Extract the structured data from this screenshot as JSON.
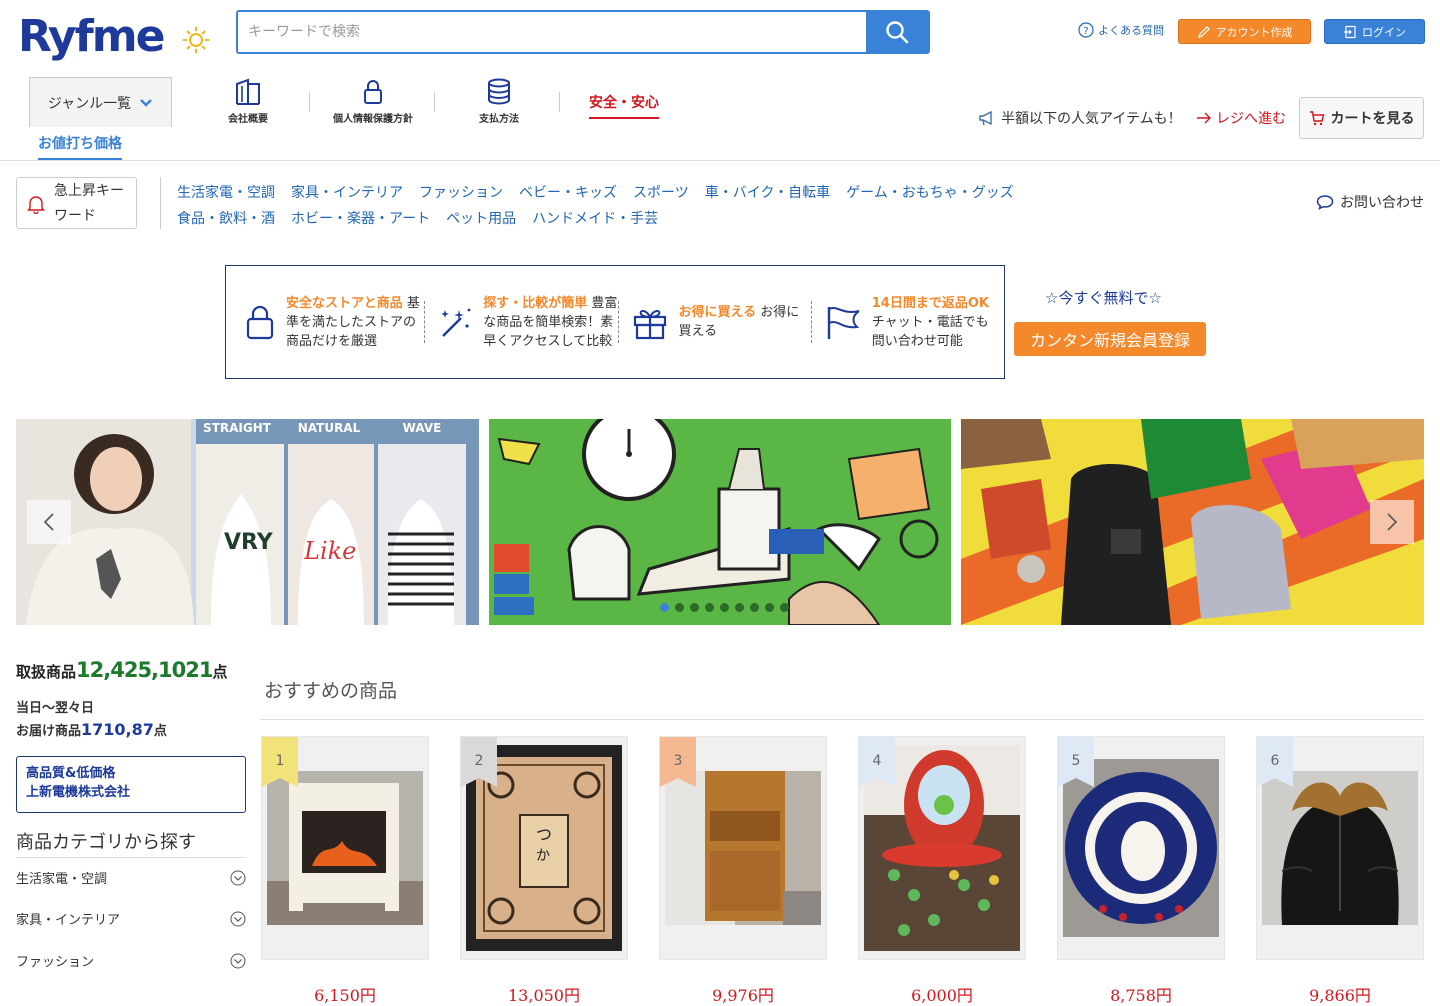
{
  "header": {
    "logo": "Ryfme",
    "search_placeholder": "キーワードで検索",
    "faq": "よくある質問",
    "signup": "アカウント作成",
    "login": "ログイン"
  },
  "nav": {
    "genre": "ジャンル一覧",
    "items": [
      {
        "label": "会社概要",
        "icon": "building-icon"
      },
      {
        "label": "個人情報保護方針",
        "icon": "lock-icon"
      },
      {
        "label": "支払方法",
        "icon": "database-icon"
      }
    ],
    "safe": "安全・安心",
    "discount_tab": "お値打ち価格",
    "half_price": "半額以下の人気アイテムも！",
    "register": "レジへ進む",
    "cart": "カートを見る"
  },
  "category_bar": {
    "trending": "急上昇キーワード",
    "categories": [
      "生活家電・空調",
      "家具・インテリア",
      "ファッション",
      "ベビー・キッズ",
      "スポーツ",
      "車・バイク・自転車",
      "ゲーム・おもちゃ・グッズ",
      "食品・飲料・酒",
      "ホビー・楽器・アート",
      "ペット用品",
      "ハンドメイド・手芸"
    ],
    "contact": "お問い合わせ"
  },
  "features": [
    {
      "highlight": "安全なストアと商品",
      "text": "基準を満たしたストアの 商品だけを厳選",
      "icon": "lock-icon"
    },
    {
      "highlight": "探す・比較が簡単",
      "text": "豊富な商品を簡単検索！素早くアクセスして比較",
      "icon": "magic-wand-icon"
    },
    {
      "highlight": "お得に買える",
      "text": "お得に買える",
      "icon": "gift-icon"
    },
    {
      "highlight": "14日間まで返品OK",
      "text": "チャット・電話でも 問い合わせ可能",
      "icon": "flag-icon"
    }
  ],
  "signup_promo": {
    "tagline": "☆今すぐ無料で☆",
    "button": "カンタン新規会員登録"
  },
  "banners": [
    {
      "labels": [
        "STRAIGHT",
        "NATURAL",
        "WAVE"
      ]
    },
    {
      "labels": []
    },
    {
      "labels": []
    }
  ],
  "sidebar": {
    "stock_prefix": "取扱商品",
    "stock_count": "12,425,1021",
    "stock_suffix": "点",
    "nextday_line1": "当日〜翌々日",
    "nextday_prefix": "お届け商品",
    "nextday_count": "1710,87",
    "nextday_suffix": "点",
    "promo_line1": "高品質&低価格",
    "promo_line2": "上新電機株式会社",
    "category_heading": "商品カテゴリから探す",
    "categories": [
      "生活家電・空調",
      "家具・インテリア",
      "ファッション"
    ]
  },
  "recommended": {
    "heading": "おすすめの商品",
    "products": [
      {
        "rank": "1",
        "price": "6,150円",
        "badge_color": "#f2e27a"
      },
      {
        "rank": "2",
        "price": "13,050円",
        "badge_color": "#d9d9d9"
      },
      {
        "rank": "3",
        "price": "9,976円",
        "badge_color": "#f4b990"
      },
      {
        "rank": "4",
        "price": "6,000円",
        "badge_color": "#dfe9f6"
      },
      {
        "rank": "5",
        "price": "8,758円",
        "badge_color": "#dfe9f6"
      },
      {
        "rank": "6",
        "price": "9,866円",
        "badge_color": "#dfe9f6"
      }
    ]
  },
  "colors": {
    "brand": "#1d3a9b",
    "accent": "#3a82d8",
    "orange": "#f4892c",
    "red": "#d4151b"
  }
}
